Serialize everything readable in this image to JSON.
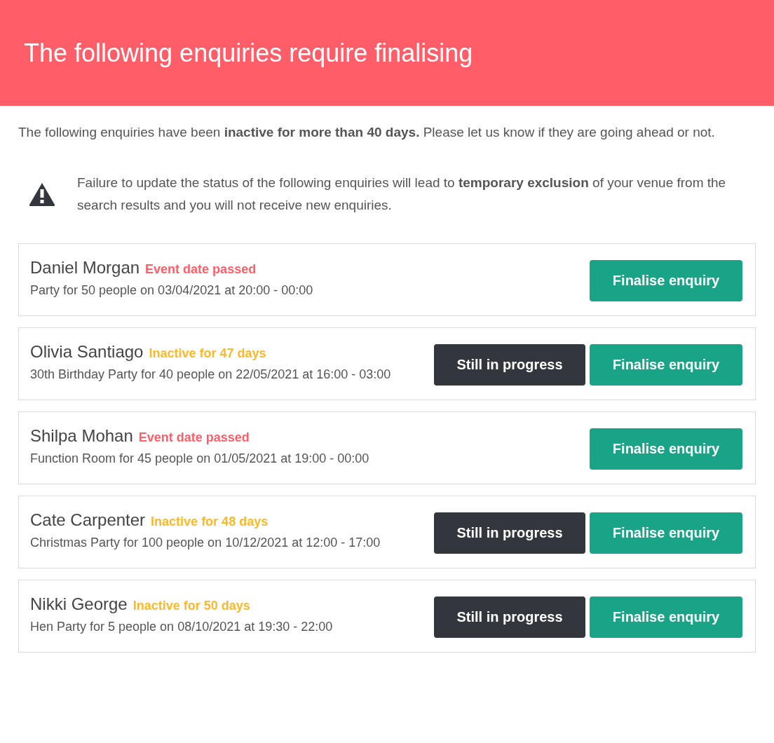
{
  "header": {
    "title": "The following enquiries require finalising"
  },
  "intro": "The following enquiries have been **inactive for more than 40 days.** Please let us know if they are going ahead or not.",
  "warning": {
    "text": "Failure to update the status of the following enquiries will lead to **temporary exclusion** of your venue from the search results and you will not receive new enquiries."
  },
  "enquiries": [
    {
      "name": "Daniel Morgan",
      "status": {
        "kind": "passed",
        "label": "Event date passed"
      },
      "details": "Party for 50 people on 03/04/2021 at 20:00 - 00:00",
      "buttons": [
        {
          "kind": "finalise",
          "label": "Finalise enquiry"
        }
      ]
    },
    {
      "name": "Olivia Santiago",
      "status": {
        "kind": "inactive",
        "label": "Inactive for 47 days"
      },
      "details": "30th Birthday Party for 40 people on 22/05/2021 at 16:00 - 03:00",
      "buttons": [
        {
          "kind": "progress",
          "label": "Still in progress"
        },
        {
          "kind": "finalise",
          "label": "Finalise enquiry"
        }
      ]
    },
    {
      "name": "Shilpa Mohan",
      "status": {
        "kind": "passed",
        "label": "Event date passed"
      },
      "details": "Function Room for 45 people on 01/05/2021 at 19:00 - 00:00",
      "buttons": [
        {
          "kind": "finalise",
          "label": "Finalise enquiry"
        }
      ]
    },
    {
      "name": "Cate Carpenter",
      "status": {
        "kind": "inactive",
        "label": "Inactive for 48 days"
      },
      "details": "Christmas Party for 100 people on 10/12/2021 at 12:00 - 17:00",
      "buttons": [
        {
          "kind": "progress",
          "label": "Still in progress"
        },
        {
          "kind": "finalise",
          "label": "Finalise enquiry"
        }
      ]
    },
    {
      "name": "Nikki George",
      "status": {
        "kind": "inactive",
        "label": "Inactive for 50 days"
      },
      "details": "Hen Party for 5 people on 08/10/2021 at 19:30 - 22:00",
      "buttons": [
        {
          "kind": "progress",
          "label": "Still in progress"
        },
        {
          "kind": "finalise",
          "label": "Finalise enquiry"
        }
      ]
    }
  ]
}
